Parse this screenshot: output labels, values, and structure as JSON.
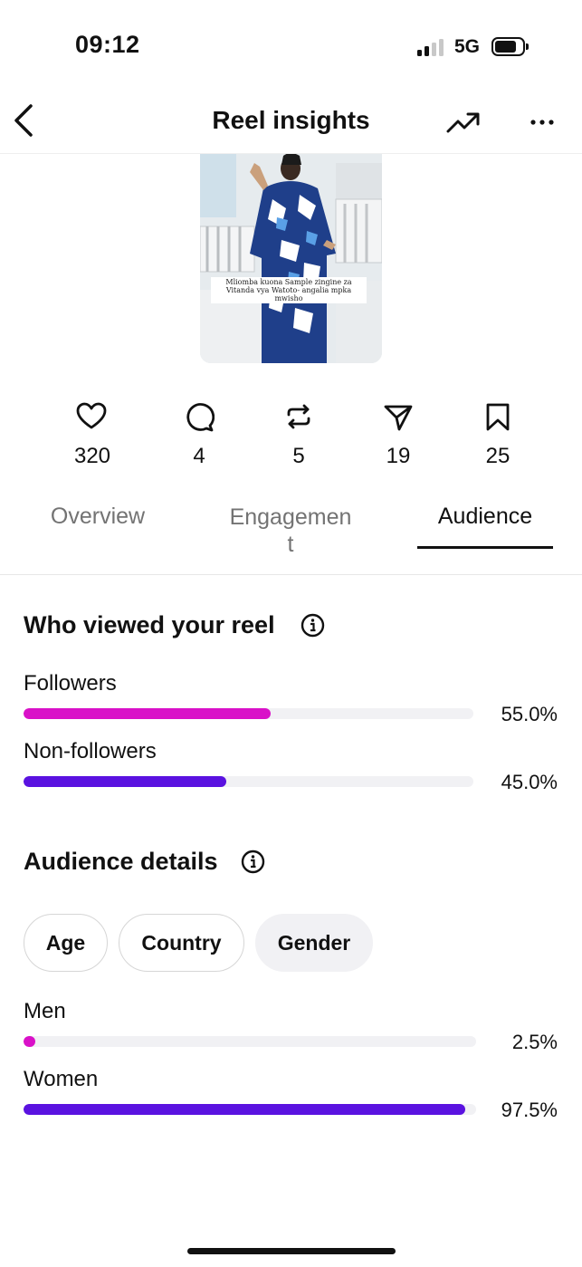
{
  "status_bar": {
    "time": "09:12",
    "network": "5G"
  },
  "header": {
    "title": "Reel insights",
    "icons": [
      "back-icon",
      "trending-icon",
      "more-icon"
    ]
  },
  "thumbnail": {
    "caption": "Mliomba kuona Sample zingine za Vitanda vya Watoto- angalia mpka mwisho"
  },
  "stats": [
    {
      "icon": "heart-icon",
      "value": "320"
    },
    {
      "icon": "comment-icon",
      "value": "4"
    },
    {
      "icon": "repost-icon",
      "value": "5"
    },
    {
      "icon": "share-icon",
      "value": "19"
    },
    {
      "icon": "bookmark-icon",
      "value": "25"
    }
  ],
  "tabs": [
    {
      "label": "Overview",
      "active": false
    },
    {
      "label": "Engagemen\nt",
      "active": false
    },
    {
      "label": "Audience",
      "active": true
    }
  ],
  "viewers": {
    "title": "Who viewed your reel",
    "rows": [
      {
        "label": "Followers",
        "value": "55.0%",
        "fraction": 0.55,
        "color": "#d911c8"
      },
      {
        "label": "Non-followers",
        "value": "45.0%",
        "fraction": 0.45,
        "color": "#5a12e0"
      }
    ]
  },
  "audience": {
    "title": "Audience details",
    "chips": [
      {
        "label": "Age",
        "active": false
      },
      {
        "label": "Country",
        "active": false
      },
      {
        "label": "Gender",
        "active": true
      }
    ],
    "rows": [
      {
        "label": "Men",
        "value": "2.5%",
        "fraction": 0.025,
        "color": "#d911c8"
      },
      {
        "label": "Women",
        "value": "97.5%",
        "fraction": 0.975,
        "color": "#5a12e0"
      }
    ]
  }
}
